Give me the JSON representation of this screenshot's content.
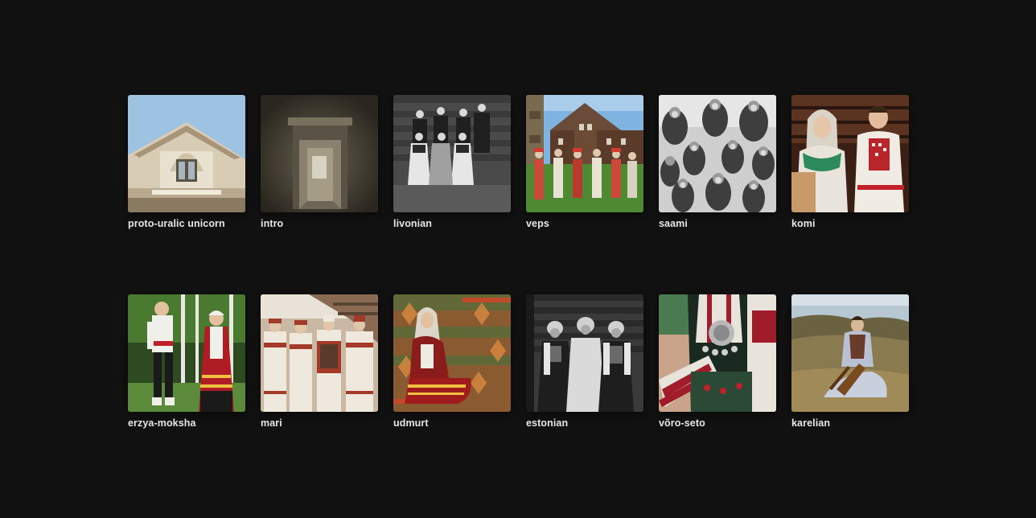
{
  "gallery": {
    "items": [
      {
        "label": "proto-uralic unicorn",
        "icon": "wooden-house-photo",
        "colors": [
          "#9fc3e0",
          "#d9cbb0",
          "#6f6250"
        ]
      },
      {
        "label": "intro",
        "icon": "empty-room-doorway-photo",
        "colors": [
          "#3a352d",
          "#6a6252",
          "#cfc6b2"
        ]
      },
      {
        "label": "livonian",
        "icon": "group-portrait-photo",
        "colors": [
          "#2b2b2b",
          "#6a6a6a",
          "#cfcfcf"
        ]
      },
      {
        "label": "veps",
        "icon": "folk-dancers-photo",
        "colors": [
          "#7fb3e0",
          "#5a3b2a",
          "#4f8a32",
          "#c94a3a"
        ]
      },
      {
        "label": "saami",
        "icon": "children-group-photo",
        "colors": [
          "#d8d8d8",
          "#4a4a4a",
          "#8a8a8a"
        ]
      },
      {
        "label": "komi",
        "icon": "couple-portrait-photo",
        "colors": [
          "#3a2014",
          "#d9d3c8",
          "#b8252a"
        ]
      },
      {
        "label": "erzya-moksha",
        "icon": "couple-in-forest-photo",
        "colors": [
          "#3f6a2a",
          "#e8e8e8",
          "#c0202a",
          "#1a1a1a"
        ]
      },
      {
        "label": "mari",
        "icon": "women-group-photo",
        "colors": [
          "#c9b8a4",
          "#a33a2a",
          "#efe8dc"
        ]
      },
      {
        "label": "udmurt",
        "icon": "woman-seated-photo",
        "colors": [
          "#a64a2a",
          "#5a6b3a",
          "#d9a050"
        ]
      },
      {
        "label": "estonian",
        "icon": "three-women-photo",
        "colors": [
          "#3a3a3a",
          "#1e1e1e",
          "#d0d0d0"
        ]
      },
      {
        "label": "võro-seto",
        "icon": "embroidered-costume-photo",
        "colors": [
          "#2f5a3a",
          "#c9c0b0",
          "#a01c2a"
        ]
      },
      {
        "label": "karelian",
        "icon": "musician-on-hill-photo",
        "colors": [
          "#b8c8d2",
          "#8a7a50",
          "#5a4a2a"
        ]
      }
    ]
  }
}
